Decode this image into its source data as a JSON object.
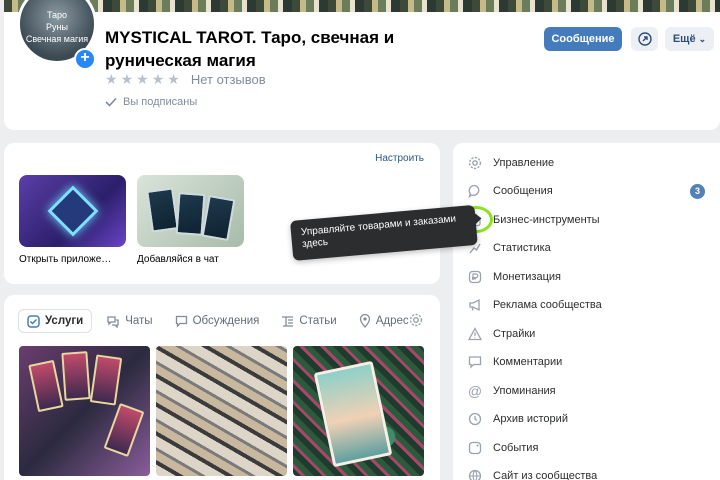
{
  "header": {
    "avatar_text": "Таро\nРуны\nСвечная магия",
    "title": "MYSTICAL TAROT. Таро, свечная и руническая магия",
    "reviews": "Нет отзывов",
    "subscribed": "Вы подписаны",
    "message_button": "Сообщение",
    "more_button": "Ещё"
  },
  "apps": {
    "configure": "Настроить",
    "items": [
      {
        "label": "Открыть приложе…"
      },
      {
        "label": "Добавляйся в чат"
      }
    ]
  },
  "tabs": [
    {
      "label": "Услуги",
      "icon": "check-square-icon"
    },
    {
      "label": "Чаты",
      "icon": "chat-bubbles-icon"
    },
    {
      "label": "Обсуждения",
      "icon": "comment-icon"
    },
    {
      "label": "Статьи",
      "icon": "article-icon"
    },
    {
      "label": "Адрес",
      "icon": "location-pin-icon"
    }
  ],
  "menu": {
    "items": [
      {
        "label": "Управление",
        "icon": "gear-icon"
      },
      {
        "label": "Сообщения",
        "icon": "message-icon",
        "badge": "3"
      },
      {
        "label": "Бизнес-инструменты",
        "icon": "shopping-bag-icon"
      },
      {
        "label": "Статистика",
        "icon": "chart-icon"
      },
      {
        "label": "Монетизация",
        "icon": "money-icon"
      },
      {
        "label": "Реклама сообщества",
        "icon": "megaphone-icon"
      },
      {
        "label": "Страйки",
        "icon": "warning-icon"
      },
      {
        "label": "Комментарии",
        "icon": "comment-icon"
      },
      {
        "label": "Упоминания",
        "icon": "at-icon"
      },
      {
        "label": "Архив историй",
        "icon": "history-icon"
      },
      {
        "label": "События",
        "icon": "event-icon"
      },
      {
        "label": "Сайт из сообщества",
        "icon": "site-icon"
      }
    ]
  },
  "tooltip": "Управляйте товарами и заказами здесь",
  "colors": {
    "primary": "#447bba",
    "link": "#2a5885",
    "highlight": "#8be31d",
    "tooltip_bg": "#2c2d2e"
  }
}
